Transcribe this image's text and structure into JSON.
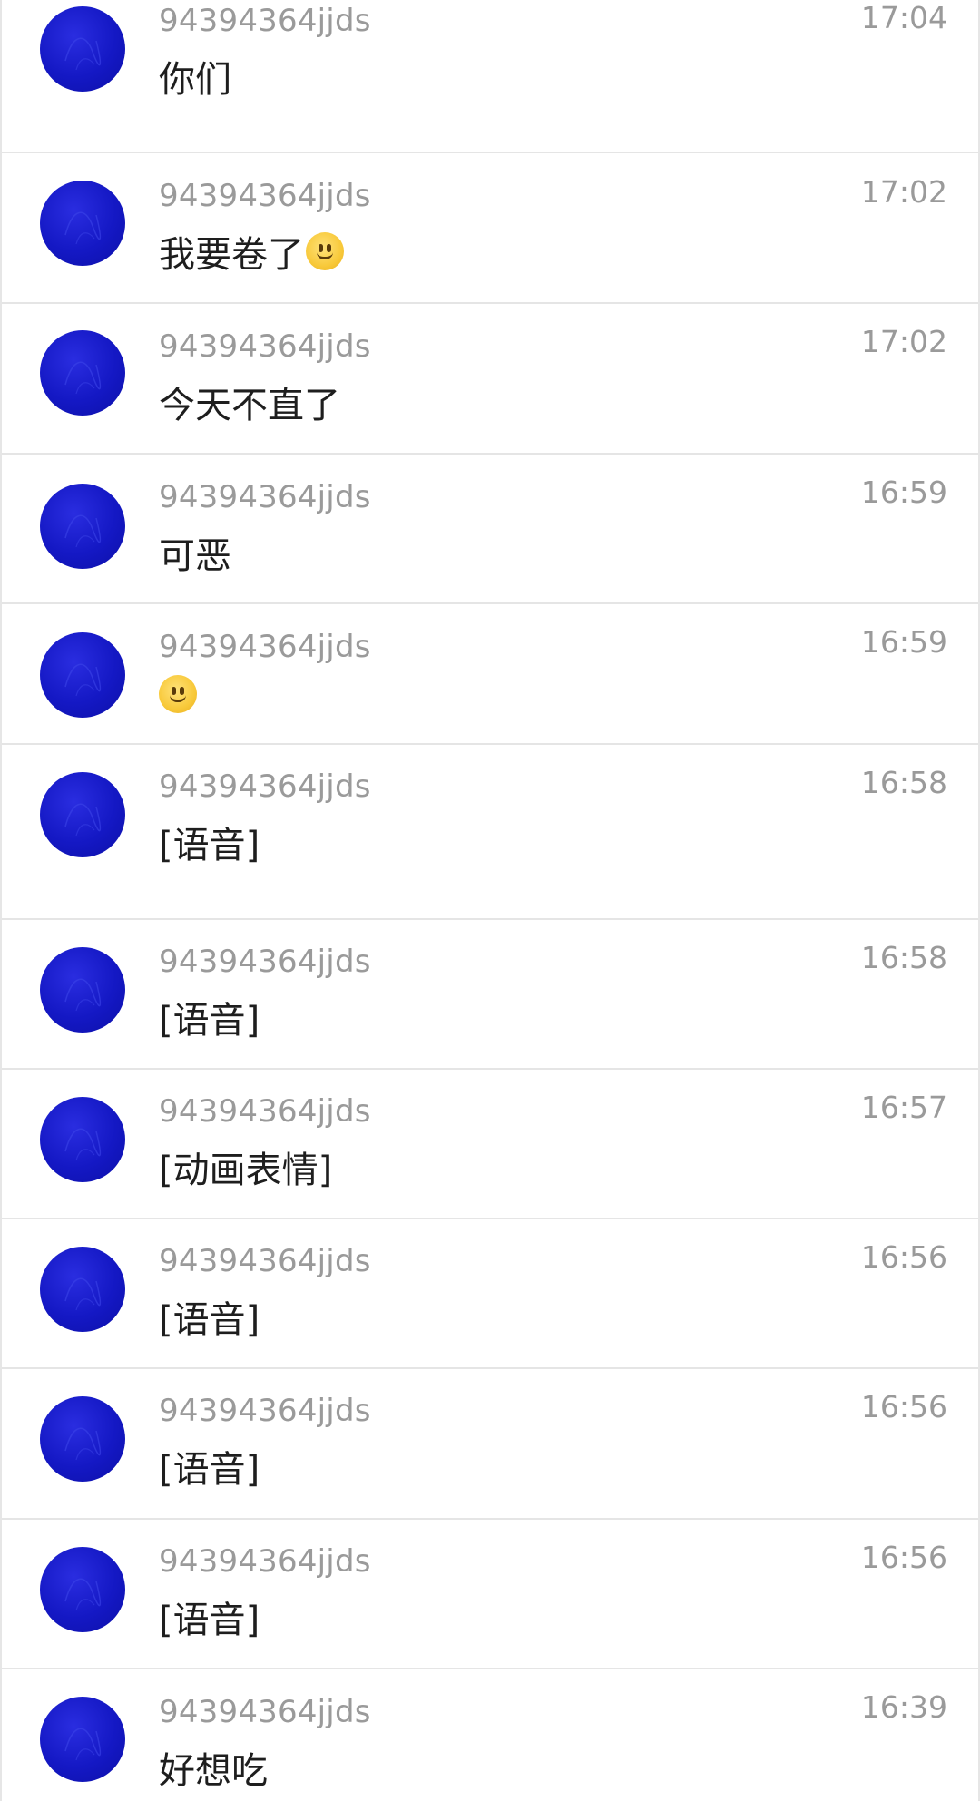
{
  "conversations": [
    {
      "sender": "94394364jjds",
      "time": "17:04",
      "message": "你们",
      "emoji": null
    },
    {
      "sender": "94394364jjds",
      "time": "17:02",
      "message": "我要卷了",
      "emoji": "slight-smile-emoji"
    },
    {
      "sender": "94394364jjds",
      "time": "17:02",
      "message": "今天不直了",
      "emoji": null
    },
    {
      "sender": "94394364jjds",
      "time": "16:59",
      "message": "可恶",
      "emoji": null
    },
    {
      "sender": "94394364jjds",
      "time": "16:59",
      "message": "",
      "emoji": "slight-smile-emoji"
    },
    {
      "sender": "94394364jjds",
      "time": "16:58",
      "message": "[语音]",
      "emoji": null
    },
    {
      "sender": "94394364jjds",
      "time": "16:58",
      "message": "[语音]",
      "emoji": null
    },
    {
      "sender": "94394364jjds",
      "time": "16:57",
      "message": "[动画表情]",
      "emoji": null
    },
    {
      "sender": "94394364jjds",
      "time": "16:56",
      "message": "[语音]",
      "emoji": null
    },
    {
      "sender": "94394364jjds",
      "time": "16:56",
      "message": "[语音]",
      "emoji": null
    },
    {
      "sender": "94394364jjds",
      "time": "16:56",
      "message": "[语音]",
      "emoji": null
    },
    {
      "sender": "94394364jjds",
      "time": "16:39",
      "message": "好想吃",
      "emoji": null
    }
  ],
  "colors": {
    "avatar": "#1418c4",
    "sender_text": "#9a9a9a",
    "message_text": "#1e1e1e",
    "divider": "#e5e5e5"
  }
}
